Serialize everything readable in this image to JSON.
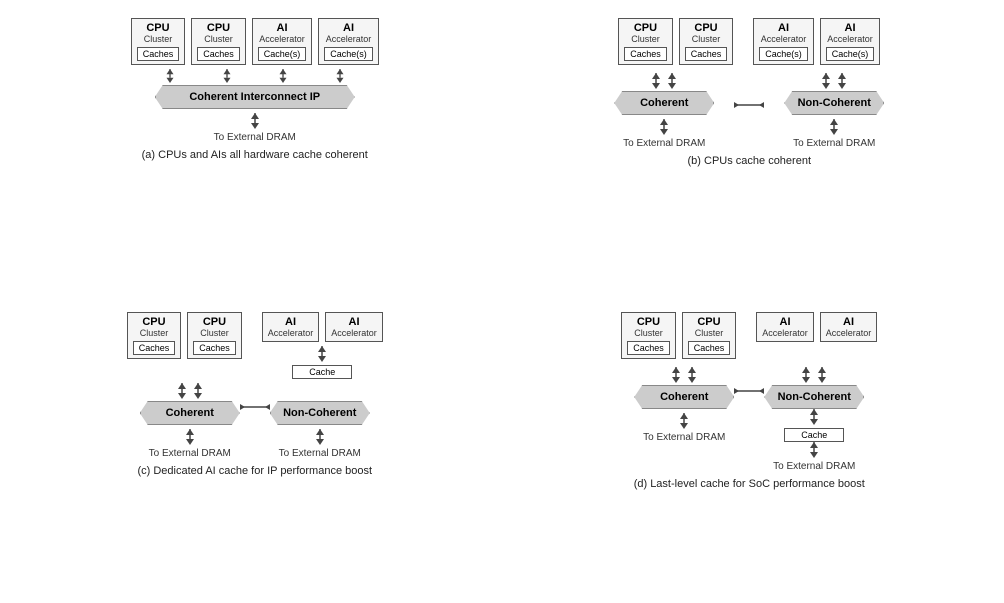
{
  "diagrams": [
    {
      "id": "a",
      "caption": "(a) CPUs and AIs all hardware cache coherent",
      "blocks": [
        {
          "title": "CPU",
          "sub": "Cluster",
          "cache": "Caches"
        },
        {
          "title": "CPU",
          "sub": "Cluster",
          "cache": "Caches"
        },
        {
          "title": "AI",
          "sub": "Accelerator",
          "cache": "Cache(s)"
        },
        {
          "title": "AI",
          "sub": "Accelerator",
          "cache": "Cache(s)"
        }
      ],
      "interconnect": "Coherent Interconnect IP",
      "dram": "To External DRAM"
    },
    {
      "id": "b",
      "caption": "(b) CPUs cache coherent",
      "left_blocks": [
        {
          "title": "CPU",
          "sub": "Cluster",
          "cache": "Caches"
        },
        {
          "title": "CPU",
          "sub": "Cluster",
          "cache": "Caches"
        }
      ],
      "right_blocks": [
        {
          "title": "AI",
          "sub": "Accelerator",
          "cache": "Cache(s)"
        },
        {
          "title": "AI",
          "sub": "Accelerator",
          "cache": "Cache(s)"
        }
      ],
      "left_banner": "Coherent",
      "right_banner": "Non-Coherent",
      "left_dram": "To External DRAM",
      "right_dram": "To External DRAM"
    },
    {
      "id": "c",
      "caption": "(c) Dedicated AI cache for IP performance boost",
      "left_blocks": [
        {
          "title": "CPU",
          "sub": "Cluster",
          "cache": "Caches"
        },
        {
          "title": "CPU",
          "sub": "Cluster",
          "cache": "Caches"
        }
      ],
      "right_blocks": [
        {
          "title": "AI",
          "sub": "Accelerator",
          "cache": ""
        },
        {
          "title": "AI",
          "sub": "Accelerator",
          "cache": ""
        }
      ],
      "right_cache": "Cache",
      "left_banner": "Coherent",
      "right_banner": "Non-Coherent",
      "left_dram": "To External DRAM",
      "right_dram": "To External DRAM"
    },
    {
      "id": "d",
      "caption": "(d) Last-level cache for SoC performance boost",
      "left_blocks": [
        {
          "title": "CPU",
          "sub": "Cluster",
          "cache": "Caches"
        },
        {
          "title": "CPU",
          "sub": "Cluster",
          "cache": "Caches"
        }
      ],
      "right_blocks": [
        {
          "title": "AI",
          "sub": "Accelerator",
          "cache": ""
        },
        {
          "title": "AI",
          "sub": "Accelerator",
          "cache": ""
        }
      ],
      "mid_cache": "Cache",
      "left_banner": "Coherent",
      "right_banner": "Non-Coherent",
      "left_dram": "To External DRAM",
      "right_dram": "To External DRAM"
    }
  ]
}
